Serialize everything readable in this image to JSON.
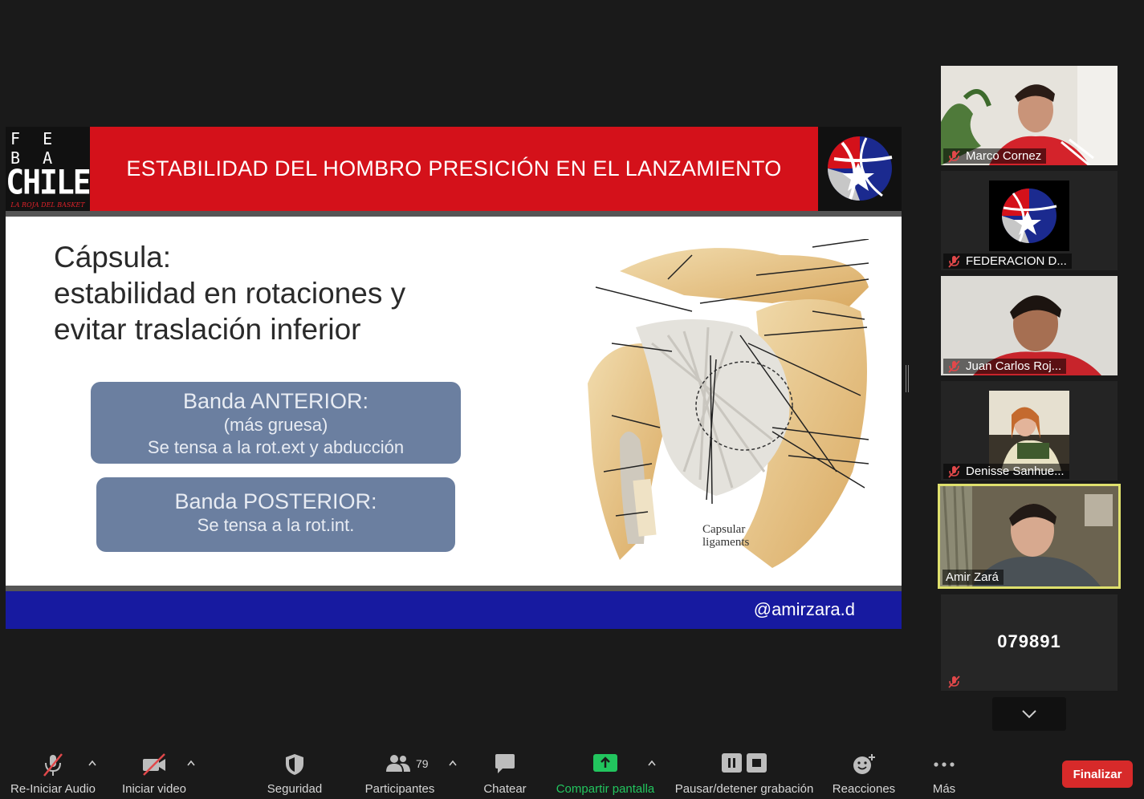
{
  "slide": {
    "logo_left": {
      "line1": "F E B A",
      "line2": "CHILE",
      "tagline": "LA ROJA DEL BASKET"
    },
    "title": "ESTABILIDAD DEL HOMBRO PRESICIÓN EN EL LANZAMIENTO",
    "heading": [
      "Cápsula:",
      "estabilidad en rotaciones y",
      "evitar traslación inferior"
    ],
    "band_anterior": {
      "title": "Banda ANTERIOR:",
      "line1": "(más gruesa)",
      "line2": "Se tensa a la rot.ext y abducción"
    },
    "band_posterior": {
      "title": "Banda POSTERIOR:",
      "line1": "Se tensa a la rot.int."
    },
    "figure_label": [
      "Capsular",
      "ligaments"
    ],
    "handle": "@amirzara.d",
    "colors": {
      "header_red": "#d4111a",
      "footer_blue": "#171aa0",
      "band": "#6b7fa0"
    }
  },
  "participants": [
    {
      "name": "Marco Cornez",
      "muted": true
    },
    {
      "name": "FEDERACION D...",
      "muted": true
    },
    {
      "name": "Juan Carlos Roj...",
      "muted": true
    },
    {
      "name": "Denisse Sanhue...",
      "muted": true
    },
    {
      "name": "Amir Zará",
      "muted": false,
      "active_speaker": true
    },
    {
      "name": "",
      "phone": "079891",
      "muted": true
    }
  ],
  "toolbar": {
    "audio": "Re-Iniciar Audio",
    "video": "Iniciar video",
    "security": "Seguridad",
    "participants": "Participantes",
    "participants_count": "79",
    "chat": "Chatear",
    "share": "Compartir pantalla",
    "record": "Pausar/detener grabación",
    "reactions": "Reacciones",
    "more": "Más",
    "end": "Finalizar",
    "share_color": "#22c55e",
    "end_color": "#d72a2a"
  }
}
